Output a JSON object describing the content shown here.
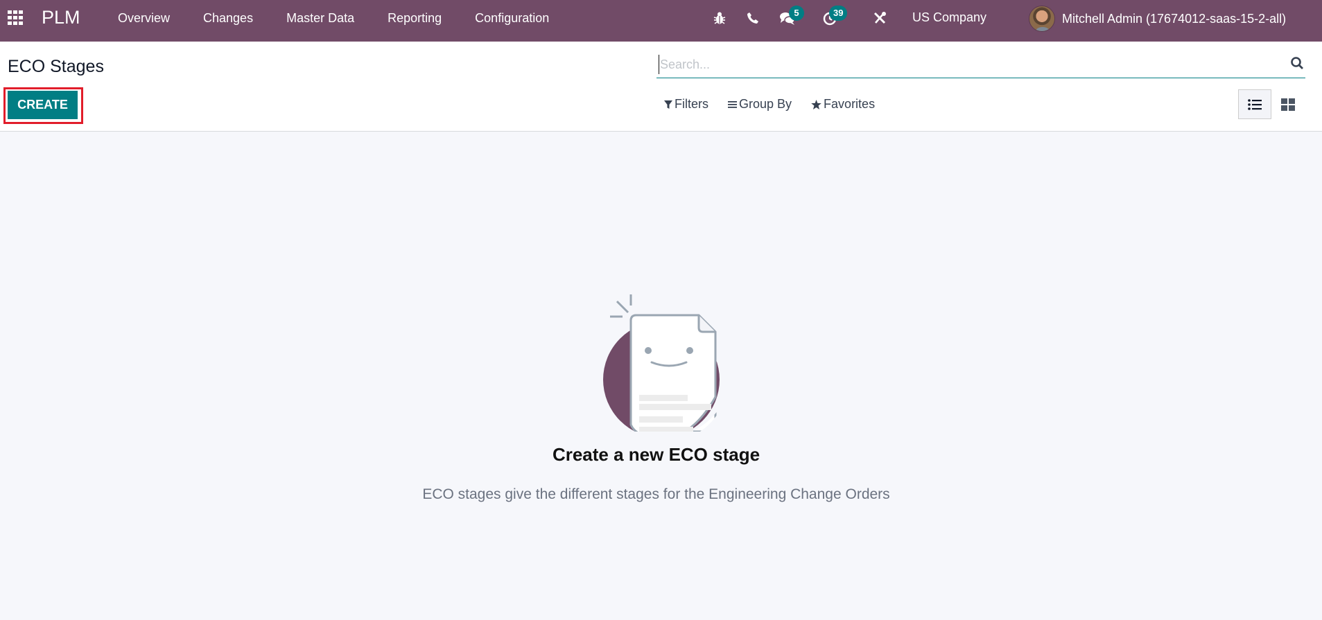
{
  "navbar": {
    "app_name": "PLM",
    "menu": [
      {
        "label": "Overview"
      },
      {
        "label": "Changes"
      },
      {
        "label": "Master Data"
      },
      {
        "label": "Reporting"
      },
      {
        "label": "Configuration"
      }
    ],
    "systray": {
      "debug_icon": "bug-icon",
      "phone_icon": "phone-icon",
      "messages_icon": "chat-icon",
      "messages_count": "5",
      "activities_icon": "clock-icon",
      "activities_count": "39",
      "settings_icon": "tools-icon"
    },
    "company": "US Company",
    "user_name": "Mitchell Admin (17674012-saas-15-2-all)"
  },
  "control_panel": {
    "title": "ECO Stages",
    "create_label": "CREATE",
    "search": {
      "placeholder": "Search...",
      "value": ""
    },
    "filters_label": "Filters",
    "group_by_label": "Group By",
    "favorites_label": "Favorites",
    "views": [
      {
        "name": "list",
        "active": true
      },
      {
        "name": "kanban",
        "active": false
      }
    ]
  },
  "empty_state": {
    "title": "Create a new ECO stage",
    "description": "ECO stages give the different stages for the Engineering Change Orders"
  },
  "colors": {
    "brand": "#714b67",
    "primary": "#017e84",
    "highlight": "#e11d2a"
  }
}
